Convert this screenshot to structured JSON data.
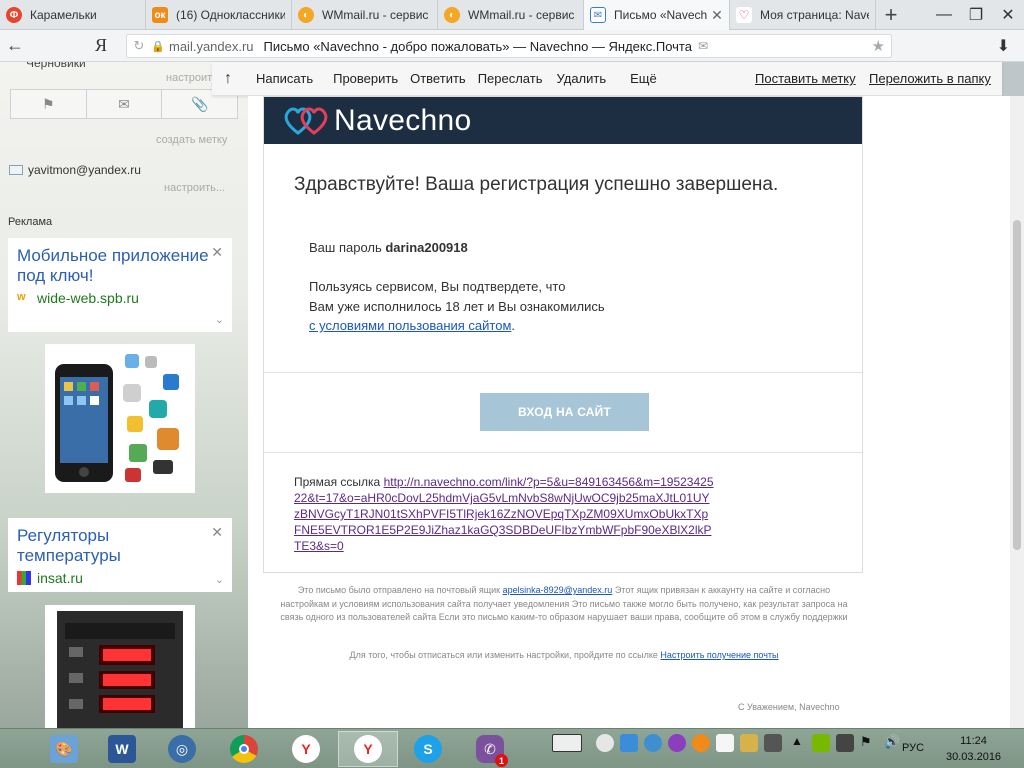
{
  "browser": {
    "tabs": [
      {
        "label": "Карамельки",
        "favicon_color": "#e8452c",
        "active": false
      },
      {
        "label": "(16) Одноклассники",
        "favicon_color": "#f08a1a",
        "active": false
      },
      {
        "label": "WMmail.ru - сервис",
        "favicon_color": "#f5a623",
        "active": false
      },
      {
        "label": "WMmail.ru - сервис",
        "favicon_color": "#f5a623",
        "active": false
      },
      {
        "label": "Письмо «Navech",
        "favicon_color": "#3a7bd5",
        "active": true
      },
      {
        "label": "Моя страница: Nave",
        "favicon_color": "#d9304a",
        "active": false
      }
    ],
    "new_tab": "+",
    "window_controls": {
      "minimize": "—",
      "maximize": "❐",
      "close": "✕"
    },
    "address": {
      "back": "←",
      "ya": "Я",
      "reload": "↻",
      "domain": "mail.yandex.ru",
      "page_title": "Письмо «Navechno - добро пожаловать» — Navechno — Яндекс.Почта",
      "mail_icon": "✉",
      "star": "★",
      "download": "⬇"
    }
  },
  "sidebar": {
    "folder_cut": "Черновики",
    "folder_setup": "настроить...",
    "create_label": "создать метку",
    "account": "yavitmon@yandex.ru",
    "account_setup": "настроить...",
    "ads_title": "Реклама",
    "ads": [
      {
        "title": "Мобильное приложение под ключ!",
        "site": "wide-web.spb.ru",
        "close": "✕",
        "chev": "⌄"
      },
      {
        "title": "Регуляторы температуры",
        "site": "insat.ru",
        "close": "✕",
        "chev": "⌄"
      }
    ]
  },
  "toolbar": {
    "up": "↑",
    "compose": "Написать",
    "check": "Проверить",
    "reply": "Ответить",
    "forward": "Переслать",
    "delete": "Удалить",
    "more": "Ещё",
    "label": "Поставить метку",
    "move": "Переложить в папку"
  },
  "message": {
    "brand": "Navechno",
    "greeting": "Здравствуйте! Ваша регистрация успешно завершена.",
    "password_label": "Ваш пароль ",
    "password_value": "darina200918",
    "terms_line1": "Пользуясь сервисом, Вы подтвердете, что",
    "terms_line2": "Вам уже исполнилось 18 лет и Вы ознакомились",
    "terms_link": "с условиями пользования сайтом",
    "terms_dot": ".",
    "login_button": "ВХОД НА САЙТ",
    "direct_label": "Прямая ссылка ",
    "direct_link": "http://n.navechno.com/link/?p=5&u=849163456&m=1952342522&t=17&o=aHR0cDovL25hdmVjaG5vLmNvbS8wNjUwOC9jb25maXJtL01UYzBNVGcyT1RJN01tSXhPVFI5TlRjek16ZzNOVEpqTXpZM09XUmxObUkxTXpFNE5EVTROR1E5P2E9JiZhaz1kaGQ3SDBDeUFIbzYmbWFpbF90eXBlX2lkPTE3&s=0",
    "footer_text_a": "Это письмо было отправлено на почтовый ящик ",
    "footer_email": "apelsinka-8929@yandex.ru",
    "footer_text_b": " Этот ящик привязан к аккаунту на сайте и согласно настройкам и условиям использования сайта получает уведомления Это письмо также могло быть получено, как результат запроса на связь одного из пользователей сайта Если это письмо каким-то образом нарушает ваши права, сообщите об этом в службу поддержки",
    "unsub_text": "Для того, чтобы отписаться или изменить настройки, пройдите по ссылке ",
    "unsub_link": "Настроить получение почты",
    "signature": "С Уважением, Navechno"
  },
  "taskbar": {
    "apps": [
      {
        "name": "paint",
        "color": "#6ba2d8",
        "label": "🎨",
        "active": false
      },
      {
        "name": "word",
        "color": "#2b5797",
        "label": "W",
        "active": false
      },
      {
        "name": "speedometer",
        "color": "#3a6ea8",
        "label": "◎",
        "active": false
      },
      {
        "name": "chrome",
        "color": "#e0b02a",
        "label": "◉",
        "active": false
      },
      {
        "name": "yandex-browser",
        "color": "#ffffff",
        "label": "Y",
        "active": false
      },
      {
        "name": "yandex-browser-2",
        "color": "#ffffff",
        "label": "Y",
        "active": true
      },
      {
        "name": "skype",
        "color": "#1da1e8",
        "label": "S",
        "active": false
      },
      {
        "name": "viber",
        "color": "#7b519d",
        "label": "✆",
        "active": false,
        "badge": "1"
      }
    ],
    "language": "РУС",
    "time": "11:24",
    "date": "30.03.2016"
  }
}
